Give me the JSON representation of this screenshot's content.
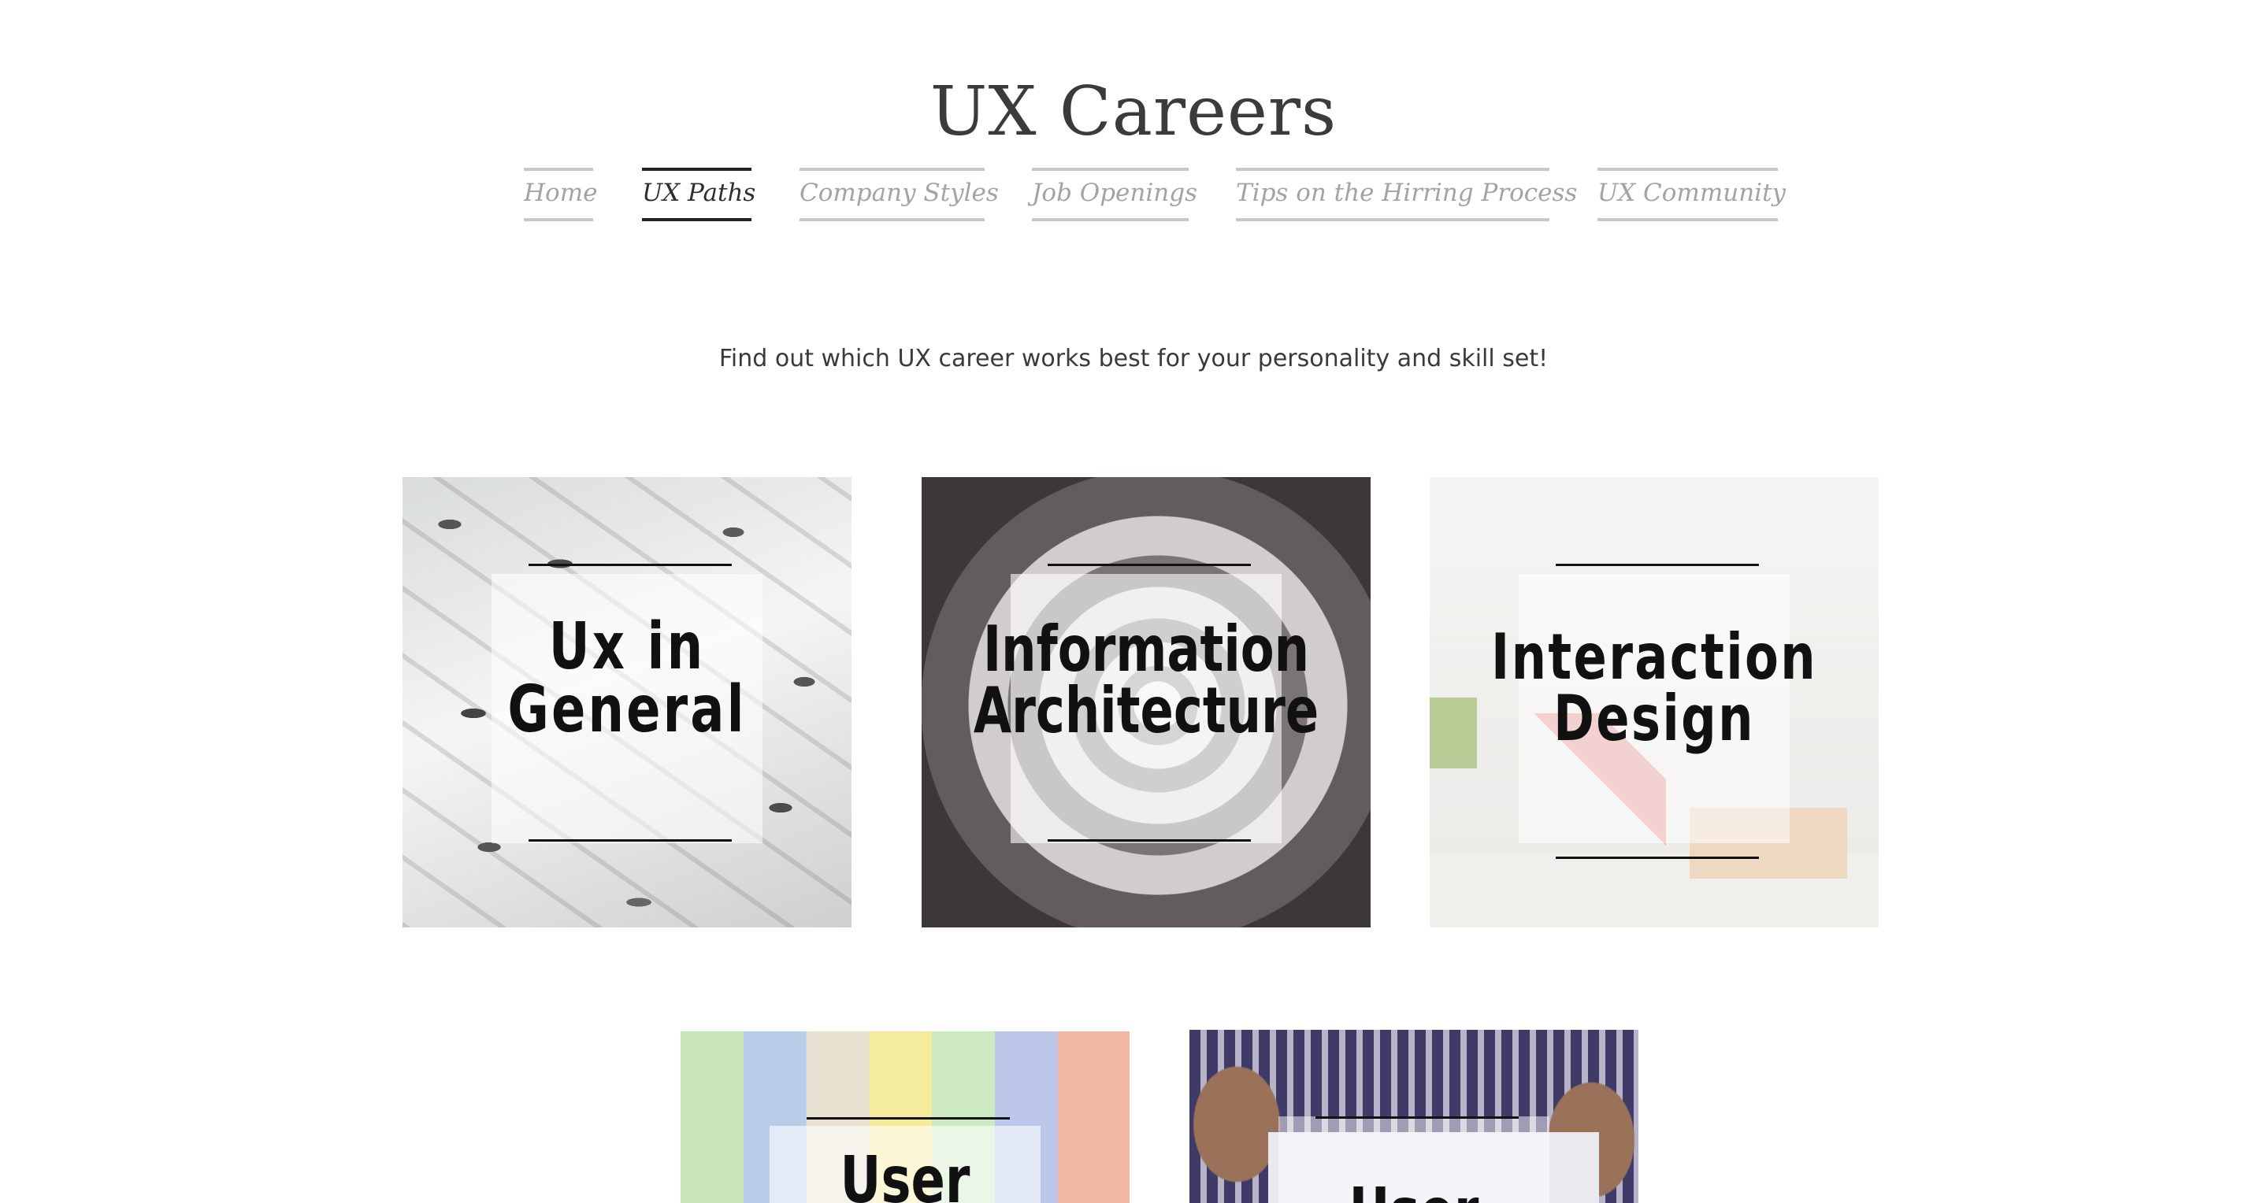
{
  "site": {
    "title": "UX Careers"
  },
  "nav": {
    "items": [
      {
        "label": "Home",
        "active": false
      },
      {
        "label": "UX Paths",
        "active": true
      },
      {
        "label": "Company Styles",
        "active": false
      },
      {
        "label": "Job Openings",
        "active": false
      },
      {
        "label": "Tips on the Hirring Process",
        "active": false
      },
      {
        "label": "UX Community",
        "active": false
      }
    ]
  },
  "intro": {
    "text": "Find out which UX career works best for your personality and skill set!"
  },
  "cards": [
    {
      "title": "Ux in\nGeneral",
      "image": "keys-photo"
    },
    {
      "title": "Information\nArchitecture",
      "image": "spiral-staircase-photo"
    },
    {
      "title": "Interaction\nDesign",
      "image": "toy-blocks-photo"
    },
    {
      "title": "User",
      "image": "chalk-photo"
    },
    {
      "title": "User",
      "image": "writing-hands-photo"
    }
  ]
}
